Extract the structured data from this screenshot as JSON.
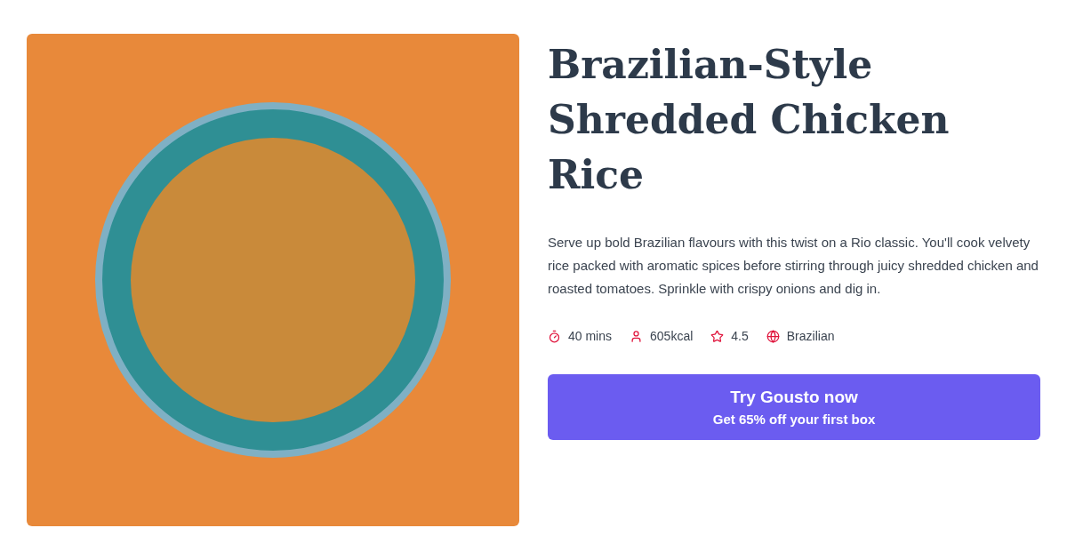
{
  "recipe": {
    "title": "Brazilian-Style Shredded Chicken Rice",
    "description": "Serve up bold Brazilian flavours with this twist on a Rio classic. You'll cook velvety rice packed with aromatic spices before stirring through juicy shredded chicken and roasted tomatoes. Sprinkle with crispy onions and dig in.",
    "meta": [
      {
        "kind": "time",
        "text": "40 mins"
      },
      {
        "kind": "calories",
        "text": "605kcal"
      },
      {
        "kind": "rating",
        "text": "4.5"
      },
      {
        "kind": "cuisine",
        "text": "Brazilian"
      }
    ]
  },
  "cta": {
    "label": "Try Gousto now",
    "sublabel": "Get 65% off your first box"
  }
}
